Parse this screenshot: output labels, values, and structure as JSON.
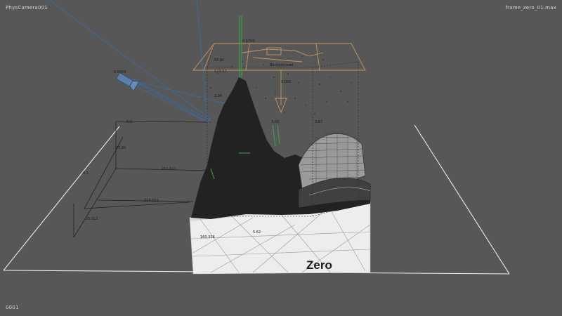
{
  "viewport": {
    "camera_label": "PhysCamera001",
    "file_label": "frame_zero_01.max",
    "frame_label": "0001"
  },
  "scene": {
    "box_text": "Zero",
    "camera_value": "0.0000",
    "gate_label": "Backgroundd",
    "top_value": "0.5700",
    "dimensions": [
      "5.0",
      "3.67",
      "0.000",
      "3.00",
      "123.57",
      "55.80",
      "3.36",
      "25.00",
      "211.811",
      "214.311",
      "25.312",
      "160.316",
      "6.1",
      "5.62"
    ]
  },
  "colors": {
    "background": "#575757",
    "wire_white": "#f2f2f2",
    "camera_blue": "#3f6a9a",
    "gate_orange": "#c89a5a",
    "helper_green": "#3aa84a"
  }
}
